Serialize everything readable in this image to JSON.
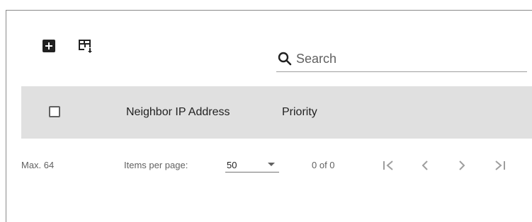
{
  "toolbar": {
    "add_icon": "add-box-icon",
    "table_icon": "table-export-icon"
  },
  "search": {
    "placeholder": "Search",
    "value": ""
  },
  "table": {
    "columns": [
      "Neighbor IP Address",
      "Priority"
    ],
    "rows": []
  },
  "footer": {
    "max_label": "Max. 64",
    "items_per_page_label": "Items per page:",
    "items_per_page_value": "50",
    "range_label": "0 of 0"
  },
  "colors": {
    "header_bg": "#e0e0e0",
    "icon": "#212121",
    "pager_icon": "#9e9e9e"
  }
}
